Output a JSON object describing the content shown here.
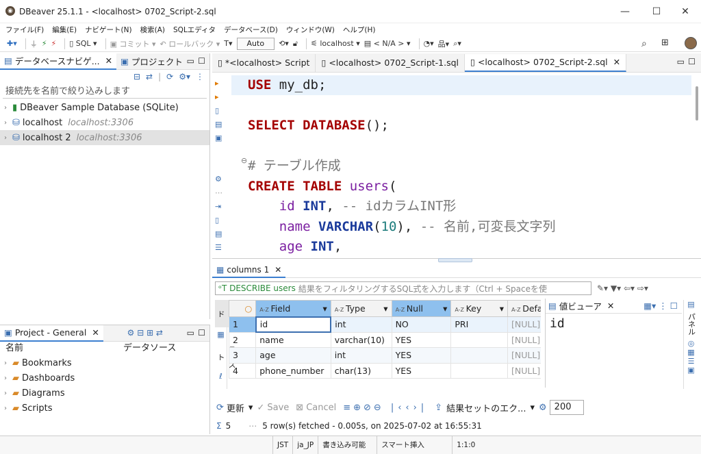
{
  "window": {
    "title": "DBeaver 25.1.1 - <localhost> 0702_Script-2.sql",
    "minimize": "—",
    "maximize": "☐",
    "close": "✕"
  },
  "menu": [
    "ファイル(F)",
    "編集(E)",
    "ナビゲート(N)",
    "検索(A)",
    "SQLエディタ",
    "データベース(D)",
    "ウィンドウ(W)",
    "ヘルプ(H)"
  ],
  "toolbar": {
    "sql": "SQL",
    "commit": "コミット",
    "rollback": "ロールバック",
    "mode": "Auto",
    "datasource": "localhost",
    "schema": "< N/A >"
  },
  "navigator": {
    "tab_db": "データベースナビゲ...",
    "tab_project": "プロジェクト",
    "filter_placeholder": "接続先を名前で絞り込みします",
    "items": [
      {
        "label": "DBeaver Sample Database (SQLite)",
        "sub": ""
      },
      {
        "label": "localhost",
        "sub": "localhost:3306"
      },
      {
        "label": "localhost 2",
        "sub": "localhost:3306"
      }
    ]
  },
  "project": {
    "tab": "Project - General",
    "col_name": "名前",
    "col_ds": "データソース",
    "items": [
      "Bookmarks",
      "Dashboards",
      "Diagrams",
      "Scripts"
    ]
  },
  "editor": {
    "tabs": [
      "*<localhost> Script",
      "<localhost> 0702_Script-1.sql",
      "<localhost> 0702_Script-2.sql"
    ]
  },
  "results": {
    "tab": "columns 1",
    "describe": "DESCRIBE users",
    "filter_placeholder": "結果をフィルタリングするSQL式を入力します（Ctrl + Spaceを使",
    "side_grid": "グリッド",
    "side_text": "テキスト",
    "columns": [
      "Field",
      "Type",
      "Null",
      "Key",
      "Defa"
    ],
    "rows": [
      {
        "n": "1",
        "field": "id",
        "type": "int",
        "null": "NO",
        "key": "PRI",
        "def": "[NULL]"
      },
      {
        "n": "2",
        "field": "name",
        "type": "varchar(10)",
        "null": "YES",
        "key": "",
        "def": "[NULL]"
      },
      {
        "n": "3",
        "field": "age",
        "type": "int",
        "null": "YES",
        "key": "",
        "def": "[NULL]"
      },
      {
        "n": "4",
        "field": "phone_number",
        "type": "char(13)",
        "null": "YES",
        "key": "",
        "def": "[NULL]"
      }
    ],
    "value_viewer_title": "値ビューア",
    "value_viewer_panel": "パネル",
    "value": "id",
    "refresh": "更新",
    "save": "Save",
    "cancel": "Cancel",
    "export": "結果セットのエク...",
    "fetch_size": "200",
    "row_count": "5",
    "status": "5 row(s) fetched - 0.005s, on 2025-07-02 at 16:55:31"
  },
  "statusbar": {
    "tz": "JST",
    "locale": "ja_JP",
    "mode": "書き込み可能",
    "insert": "スマート挿入",
    "pos": "1:1:0"
  }
}
